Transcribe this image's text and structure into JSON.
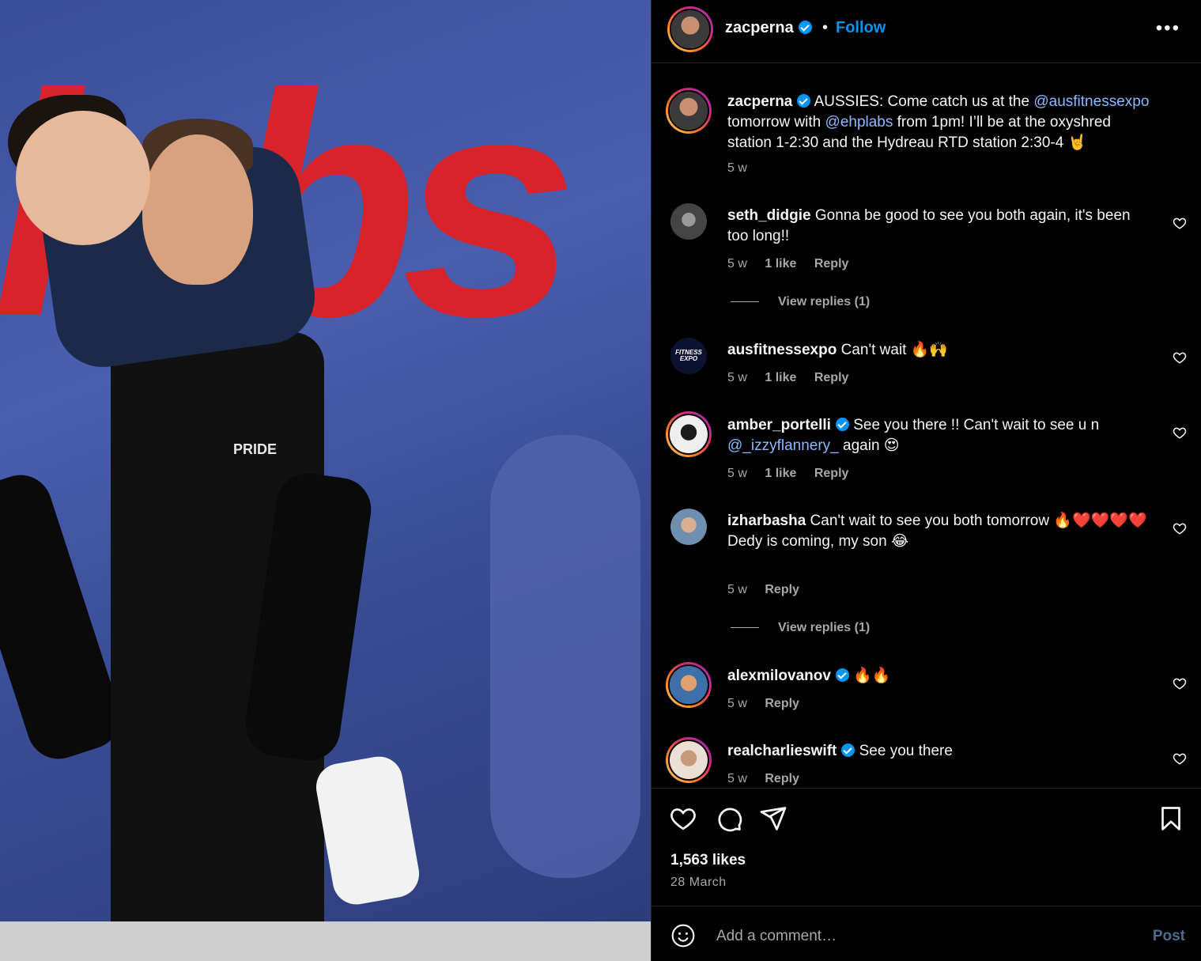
{
  "post": {
    "author": "zacperna",
    "follow_label": "Follow",
    "separator": "•",
    "more_label": "•••",
    "caption_username": "zacperna",
    "caption_parts": {
      "p1": "AUSSIES: Come catch us at the ",
      "m1": "@ausfitnessexpo",
      "p2": " tomorrow with ",
      "m2": "@ehplabs",
      "p3": " from 1pm! I’ll be at the oxyshred station 1-2:30 and the Hydreau RTD station 2:30-4 🤘"
    },
    "caption_time": "5 w",
    "likes": "1,563 likes",
    "date": "28 March",
    "photo_shirt_text": "PRIDE",
    "photo_banner_text": "labs"
  },
  "comments": [
    {
      "username": "seth_didgie",
      "verified": false,
      "text": "Gonna be good to see you both again, it's been too long!!",
      "time": "5 w",
      "likes": "1 like",
      "reply": "Reply",
      "view_replies": "View replies (1)",
      "avatar_color": "#6b6b6b"
    },
    {
      "username": "ausfitnessexpo",
      "verified": false,
      "text": "Can't wait 🔥🙌",
      "time": "5 w",
      "likes": "1 like",
      "reply": "Reply",
      "avatar_label": "FITNESS EXPO",
      "avatar_color": "#0c1230"
    },
    {
      "username": "amber_portelli",
      "verified": true,
      "text_pre": "See you there !! Can't wait to see u n ",
      "mention": "@_izzyflannery_",
      "text_post": " again 😍",
      "time": "5 w",
      "likes": "1 like",
      "reply": "Reply",
      "avatar_color": "#e8e8e8"
    },
    {
      "username": "izharbasha",
      "verified": false,
      "text": "Can't wait to see you both tomorrow 🔥❤️❤️❤️❤️",
      "text2": "Dedy is coming, my son 😂",
      "time": "5 w",
      "reply": "Reply",
      "view_replies": "View replies (1)",
      "avatar_color": "#8aa0b8"
    },
    {
      "username": "alexmilovanov",
      "verified": true,
      "text": "🔥🔥",
      "time": "5 w",
      "reply": "Reply",
      "avatar_color": "#c07040"
    },
    {
      "username": "realcharlieswift",
      "verified": true,
      "text": "See you there",
      "time": "5 w",
      "reply": "Reply",
      "avatar_color": "#d9c2a8"
    }
  ],
  "comment_box": {
    "placeholder": "Add a comment…",
    "post_label": "Post"
  },
  "icons": {
    "like": "heart-icon",
    "comment": "comment-icon",
    "share": "share-icon",
    "save": "bookmark-icon",
    "emoji": "emoji-icon"
  },
  "colors": {
    "accent": "#0095f6",
    "background": "#000000",
    "muted": "#a8a8a8",
    "mention": "#8cb8ff"
  }
}
